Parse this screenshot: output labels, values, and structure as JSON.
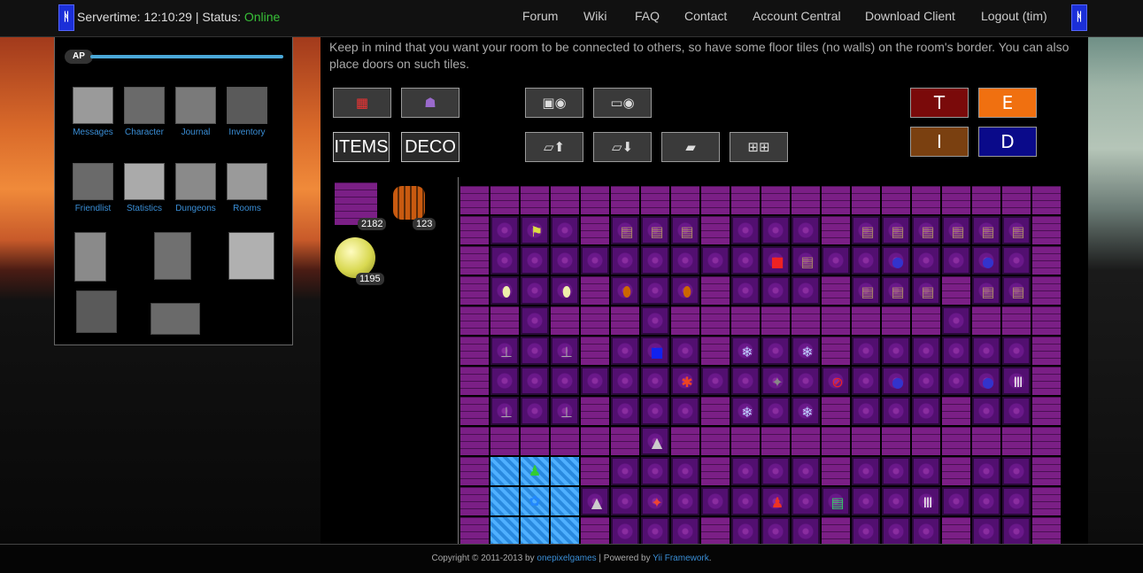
{
  "header": {
    "servertime_label": "Servertime: 12:10:29 | Status: ",
    "status": "Online",
    "logo_glyph": "ᚻ",
    "nav": [
      "Forum",
      "Wiki",
      "FAQ",
      "Contact",
      "Account Central",
      "Download Client",
      "Logout (tim)"
    ]
  },
  "sidebar": {
    "ap_label": "AP",
    "menu": [
      "Messages",
      "Character",
      "Journal",
      "Inventory",
      "Friendlist",
      "Statistics",
      "Dungeons",
      "Rooms"
    ]
  },
  "main": {
    "info": "Keep in mind that you want your room to be connected to others, so have some floor tiles (no walls) on the room's border. You can also place doors on such tiles.",
    "items_button": "ITEMS",
    "deco_button": "DECO",
    "letters": [
      "T",
      "E",
      "I",
      "D"
    ],
    "letter_colors": [
      "#7a0a0a",
      "#f07010",
      "#7a4010",
      "#0a0a8a"
    ],
    "palette_counts": [
      "2182",
      "123",
      "1195"
    ]
  },
  "footer": {
    "prefix": "Copyright © 2011-2013 by ",
    "company": "onepixelgames",
    "middle": " | Powered by ",
    "framework": "Yii Framework",
    "suffix": "."
  }
}
